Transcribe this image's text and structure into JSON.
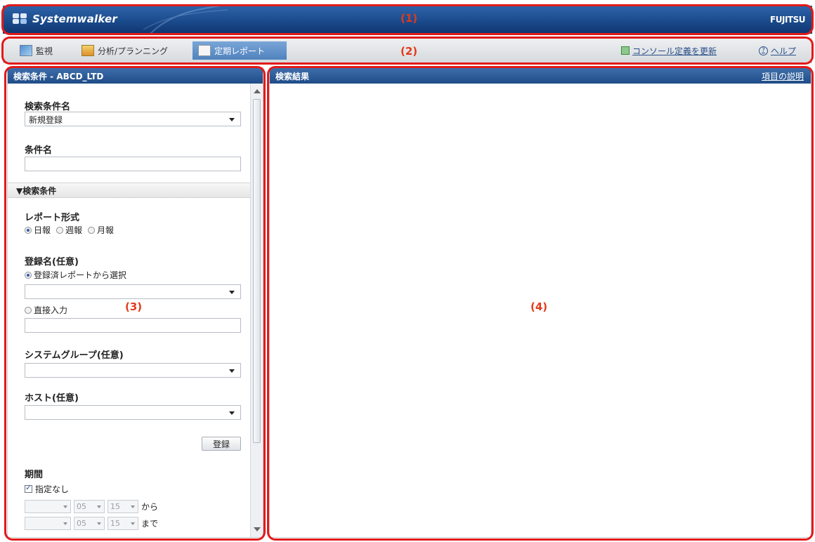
{
  "header": {
    "app_title": "Systemwalker",
    "brand": "FUJITSU"
  },
  "toolbar": {
    "tabs": [
      {
        "label": "監視",
        "icon": "monitor-icon"
      },
      {
        "label": "分析/プランニング",
        "icon": "chart-icon"
      },
      {
        "label": "定期レポート",
        "icon": "report-icon",
        "active": true
      }
    ],
    "refresh_label": "コンソール定義を更新",
    "help_label": "ヘルプ"
  },
  "annotations": {
    "a1": "(1)",
    "a2": "(2)",
    "a3": "(3)",
    "a4": "(4)"
  },
  "search_panel": {
    "title": "検索条件 - ABCD_LTD",
    "condition_list_label": "検索条件名",
    "condition_list_value": "新規登録",
    "condition_name_label": "条件名",
    "condition_name_value": "",
    "section_label": "▼検索条件",
    "report_format_label": "レポート形式",
    "report_formats": [
      {
        "label": "日報",
        "checked": true
      },
      {
        "label": "週報",
        "checked": false
      },
      {
        "label": "月報",
        "checked": false
      }
    ],
    "register_name_label": "登録名(任意)",
    "register_opt1": "登録済レポートから選択",
    "register_opt2": "直接入力",
    "system_group_label": "システムグループ(任意)",
    "host_label": "ホスト(任意)",
    "register_button": "登録",
    "period_label": "期間",
    "no_period_label": "指定なし",
    "date_from": {
      "month": "05",
      "day": "15",
      "suffix": "から"
    },
    "date_to": {
      "month": "05",
      "day": "15",
      "suffix": "まで"
    }
  },
  "results_panel": {
    "title": "検索結果",
    "help_link": "項目の説明"
  }
}
